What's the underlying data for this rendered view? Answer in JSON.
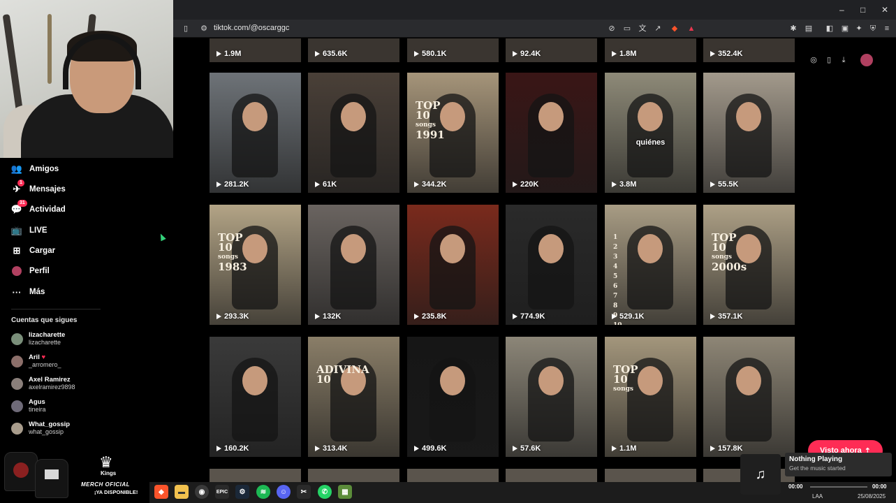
{
  "browser": {
    "url": "tiktok.com/@oscarggc",
    "window_controls": [
      "–",
      "□",
      "✕"
    ]
  },
  "nav": {
    "items": [
      {
        "label": "Amigos",
        "icon": "friends-icon",
        "glyph": "👥",
        "badge": ""
      },
      {
        "label": "Mensajes",
        "icon": "messages-icon",
        "glyph": "✈",
        "badge": "1"
      },
      {
        "label": "Actividad",
        "icon": "activity-icon",
        "glyph": "💬",
        "badge": "31"
      },
      {
        "label": "LIVE",
        "icon": "live-icon",
        "glyph": "📺",
        "badge": ""
      },
      {
        "label": "Cargar",
        "icon": "upload-icon",
        "glyph": "⊞",
        "badge": ""
      },
      {
        "label": "Perfil",
        "icon": "profile-icon",
        "glyph": "●",
        "badge": ""
      },
      {
        "label": "Más",
        "icon": "more-icon",
        "glyph": "···",
        "badge": ""
      }
    ]
  },
  "following": {
    "title": "Cuentas que sigues",
    "accounts": [
      {
        "name": "lizacharette",
        "handle": "lizacharette",
        "color": "#7a8f7a"
      },
      {
        "name": "Aril",
        "handle": "_arromero_",
        "color": "#8c6f6a"
      },
      {
        "name": "Axel Ramirez",
        "handle": "axelramirez9898",
        "color": "#8a7f7a"
      },
      {
        "name": "Agus",
        "handle": "tineira",
        "color": "#6e6a78"
      },
      {
        "name": "What_gossip",
        "handle": "what_gossip",
        "color": "#a89c8c"
      }
    ]
  },
  "merch": {
    "brand": "Kings",
    "line1": "MERCH OFICIAL",
    "line2": "¡YA DISPONIBLE!"
  },
  "videos": {
    "top_strip": [
      "1.9M",
      "635.6K",
      "580.1K",
      "92.4K",
      "1.8M",
      "352.4K"
    ],
    "rows": [
      [
        {
          "views": "281.2K",
          "bg": "#6e7378",
          "overlay": "",
          "caption": ""
        },
        {
          "views": "61K",
          "bg": "#4a4038",
          "overlay": "",
          "caption": ""
        },
        {
          "views": "344.2K",
          "bg": "#a6957a",
          "overlay": "TOP|10|songs|1991",
          "caption": ""
        },
        {
          "views": "220K",
          "bg": "#3a1616",
          "overlay": "",
          "caption": ""
        },
        {
          "views": "3.8M",
          "bg": "#8e8a78",
          "overlay": "",
          "caption": "quiénes"
        },
        {
          "views": "55.5K",
          "bg": "#a39a8c",
          "overlay": "",
          "caption": ""
        }
      ],
      [
        {
          "views": "293.3K",
          "bg": "#b3a486",
          "overlay": "TOP|10|songs|1983",
          "caption": ""
        },
        {
          "views": "132K",
          "bg": "#6a6460",
          "overlay": "",
          "caption": ""
        },
        {
          "views": "235.8K",
          "bg": "#7a2a1c",
          "overlay": "",
          "caption": ""
        },
        {
          "views": "774.9K",
          "bg": "#2a2a2a",
          "overlay": "",
          "caption": ""
        },
        {
          "views": "529.1K",
          "bg": "#a89c84",
          "overlay": "1|2|3|4|5|6|7|8|9|10",
          "caption": ""
        },
        {
          "views": "357.1K",
          "bg": "#ada086",
          "overlay": "TOP|10|songs|2000s",
          "caption": ""
        }
      ],
      [
        {
          "views": "160.2K",
          "bg": "#3a3a3a",
          "overlay": "",
          "caption": ""
        },
        {
          "views": "313.4K",
          "bg": "#8a7e68",
          "overlay": "ADIVINA|10",
          "caption": ""
        },
        {
          "views": "499.6K",
          "bg": "#161616",
          "overlay": "",
          "caption": ""
        },
        {
          "views": "57.6K",
          "bg": "#8c8678",
          "overlay": "",
          "caption": ""
        },
        {
          "views": "1.1M",
          "bg": "#a3967c",
          "overlay": "TOP|10|songs",
          "caption": ""
        },
        {
          "views": "157.8K",
          "bg": "#8e8676",
          "overlay": "",
          "caption": ""
        }
      ]
    ]
  },
  "visto_button": "Visto ahora",
  "media": {
    "title": "Nothing Playing",
    "subtitle": "Get the music started",
    "time_start": "00:00",
    "time_end": "00:00"
  },
  "tray": {
    "lang": "LAA",
    "date": "25/08/2025"
  },
  "colors": {
    "accent": "#fe2c55",
    "background": "#000000"
  }
}
